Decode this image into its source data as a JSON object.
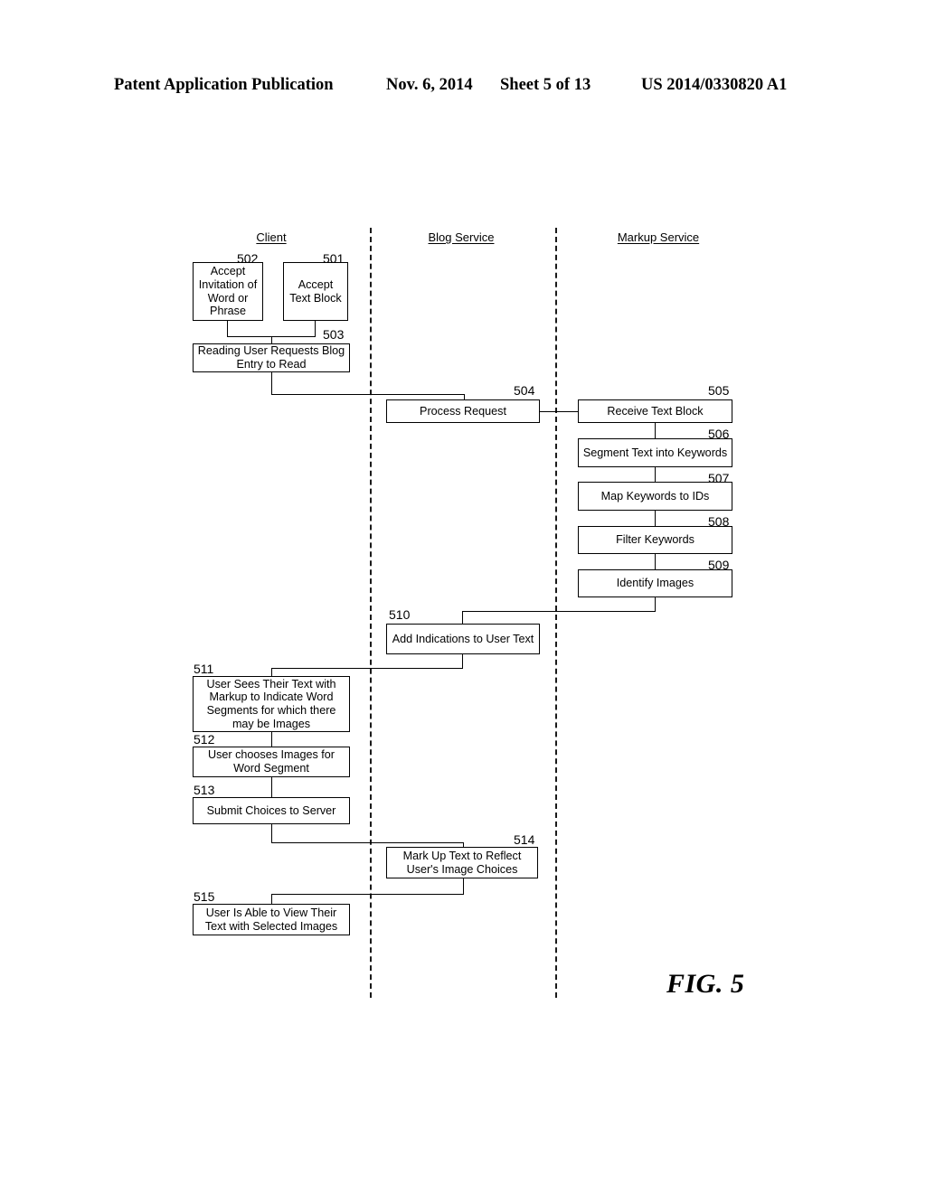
{
  "header": {
    "publication": "Patent Application Publication",
    "date": "Nov. 6, 2014",
    "sheet": "Sheet 5 of 13",
    "patent_number": "US 2014/0330820 A1"
  },
  "figure": {
    "caption": "FIG. 5",
    "lanes": [
      {
        "id": "client",
        "label": "Client"
      },
      {
        "id": "blog-service",
        "label": "Blog Service"
      },
      {
        "id": "markup-service",
        "label": "Markup Service"
      }
    ],
    "boxes": [
      {
        "ref": "502",
        "label": "Accept Invitation of Word or Phrase",
        "lane": "client"
      },
      {
        "ref": "501",
        "label": "Accept Text Block",
        "lane": "client"
      },
      {
        "ref": "503",
        "label": "Reading User Requests Blog Entry to Read",
        "lane": "client"
      },
      {
        "ref": "504",
        "label": "Process Request",
        "lane": "blog-service"
      },
      {
        "ref": "505",
        "label": "Receive Text Block",
        "lane": "markup-service"
      },
      {
        "ref": "506",
        "label": "Segment Text into Keywords",
        "lane": "markup-service"
      },
      {
        "ref": "507",
        "label": "Map Keywords to IDs",
        "lane": "markup-service"
      },
      {
        "ref": "508",
        "label": "Filter Keywords",
        "lane": "markup-service"
      },
      {
        "ref": "509",
        "label": "Identify Images",
        "lane": "markup-service"
      },
      {
        "ref": "510",
        "label": "Add Indications to User Text",
        "lane": "blog-service"
      },
      {
        "ref": "511",
        "label": "User Sees Their Text with Markup to Indicate Word Segments for which there may be Images",
        "lane": "client"
      },
      {
        "ref": "512",
        "label": "User chooses Images for Word Segment",
        "lane": "client"
      },
      {
        "ref": "513",
        "label": "Submit Choices to Server",
        "lane": "client"
      },
      {
        "ref": "514",
        "label": "Mark Up Text to Reflect User's Image Choices",
        "lane": "blog-service"
      },
      {
        "ref": "515",
        "label": "User Is Able to View Their Text with Selected Images",
        "lane": "client"
      }
    ]
  },
  "colors": {
    "ink": "#000000",
    "paper": "#ffffff"
  }
}
